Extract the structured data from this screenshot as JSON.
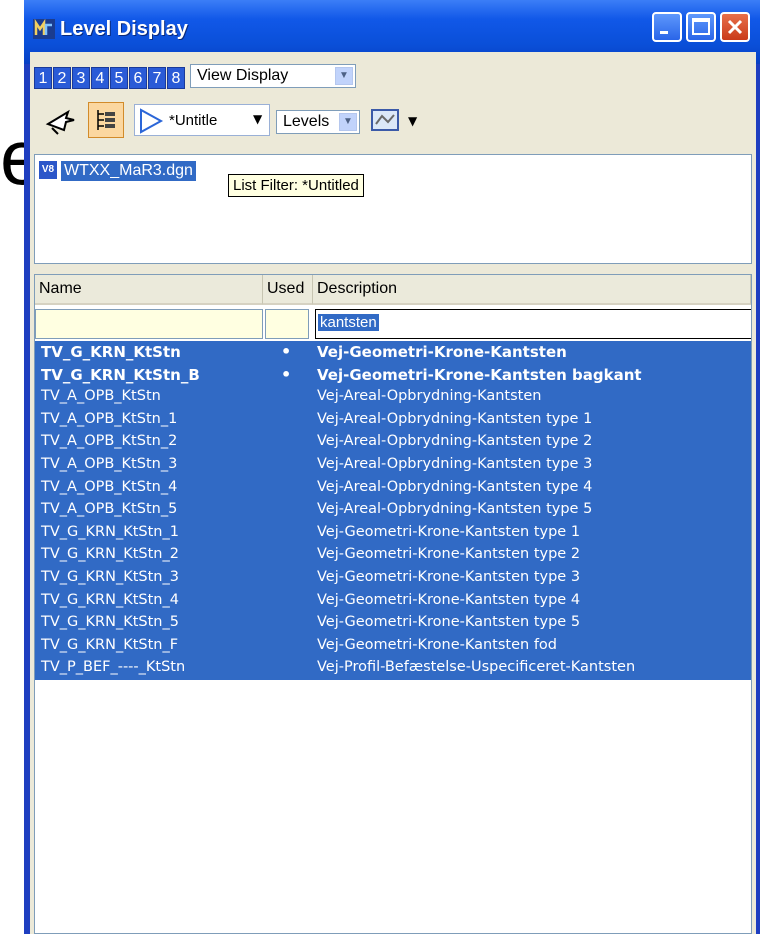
{
  "background_letter": "e",
  "window": {
    "title": "Level Display"
  },
  "toolbar": {
    "view_numbers": [
      "1",
      "2",
      "3",
      "4",
      "5",
      "6",
      "7",
      "8"
    ],
    "view_display": "View Display",
    "filter_value": "*Untitle",
    "levels_value": "Levels"
  },
  "file_list": {
    "file_name": "WTXX_MaR3.dgn",
    "tooltip": "List Filter: *Untitled"
  },
  "level_table": {
    "columns": [
      "Name",
      "Used",
      "Description"
    ],
    "filter": {
      "name": "",
      "used": "",
      "description": "kantsten"
    },
    "rows": [
      {
        "name": "TV_G_KRN_KtStn",
        "used": "•",
        "description": "Vej-Geometri-Krone-Kantsten",
        "bold": true
      },
      {
        "name": "TV_G_KRN_KtStn_B",
        "used": "•",
        "description": "Vej-Geometri-Krone-Kantsten bagkant",
        "bold": true
      },
      {
        "name": "TV_A_OPB_KtStn",
        "used": "",
        "description": "Vej-Areal-Opbrydning-Kantsten",
        "bold": false
      },
      {
        "name": "TV_A_OPB_KtStn_1",
        "used": "",
        "description": "Vej-Areal-Opbrydning-Kantsten type 1",
        "bold": false
      },
      {
        "name": "TV_A_OPB_KtStn_2",
        "used": "",
        "description": "Vej-Areal-Opbrydning-Kantsten type 2",
        "bold": false
      },
      {
        "name": "TV_A_OPB_KtStn_3",
        "used": "",
        "description": "Vej-Areal-Opbrydning-Kantsten type 3",
        "bold": false
      },
      {
        "name": "TV_A_OPB_KtStn_4",
        "used": "",
        "description": "Vej-Areal-Opbrydning-Kantsten type 4",
        "bold": false
      },
      {
        "name": "TV_A_OPB_KtStn_5",
        "used": "",
        "description": "Vej-Areal-Opbrydning-Kantsten type 5",
        "bold": false
      },
      {
        "name": "TV_G_KRN_KtStn_1",
        "used": "",
        "description": "Vej-Geometri-Krone-Kantsten type 1",
        "bold": false
      },
      {
        "name": "TV_G_KRN_KtStn_2",
        "used": "",
        "description": "Vej-Geometri-Krone-Kantsten type 2",
        "bold": false
      },
      {
        "name": "TV_G_KRN_KtStn_3",
        "used": "",
        "description": "Vej-Geometri-Krone-Kantsten type 3",
        "bold": false
      },
      {
        "name": "TV_G_KRN_KtStn_4",
        "used": "",
        "description": "Vej-Geometri-Krone-Kantsten type 4",
        "bold": false
      },
      {
        "name": "TV_G_KRN_KtStn_5",
        "used": "",
        "description": "Vej-Geometri-Krone-Kantsten type 5",
        "bold": false
      },
      {
        "name": "TV_G_KRN_KtStn_F",
        "used": "",
        "description": "Vej-Geometri-Krone-Kantsten fod",
        "bold": false
      },
      {
        "name": "TV_P_BEF_----_KtStn",
        "used": "",
        "description": "Vej-Profil-Befæstelse-Uspecificeret-Kantsten",
        "bold": false
      }
    ]
  },
  "colors": {
    "selection": "#316ac5",
    "titlebar": "#0a4fd8",
    "face": "#ece9d8"
  },
  "icons": [
    "microstation-icon",
    "minimize-icon",
    "maximize-icon",
    "close-icon",
    "select-pointer-icon",
    "level-list-icon",
    "filter-icon",
    "dropdown-arrow-icon",
    "level-manager-icon",
    "v8-file-icon"
  ]
}
